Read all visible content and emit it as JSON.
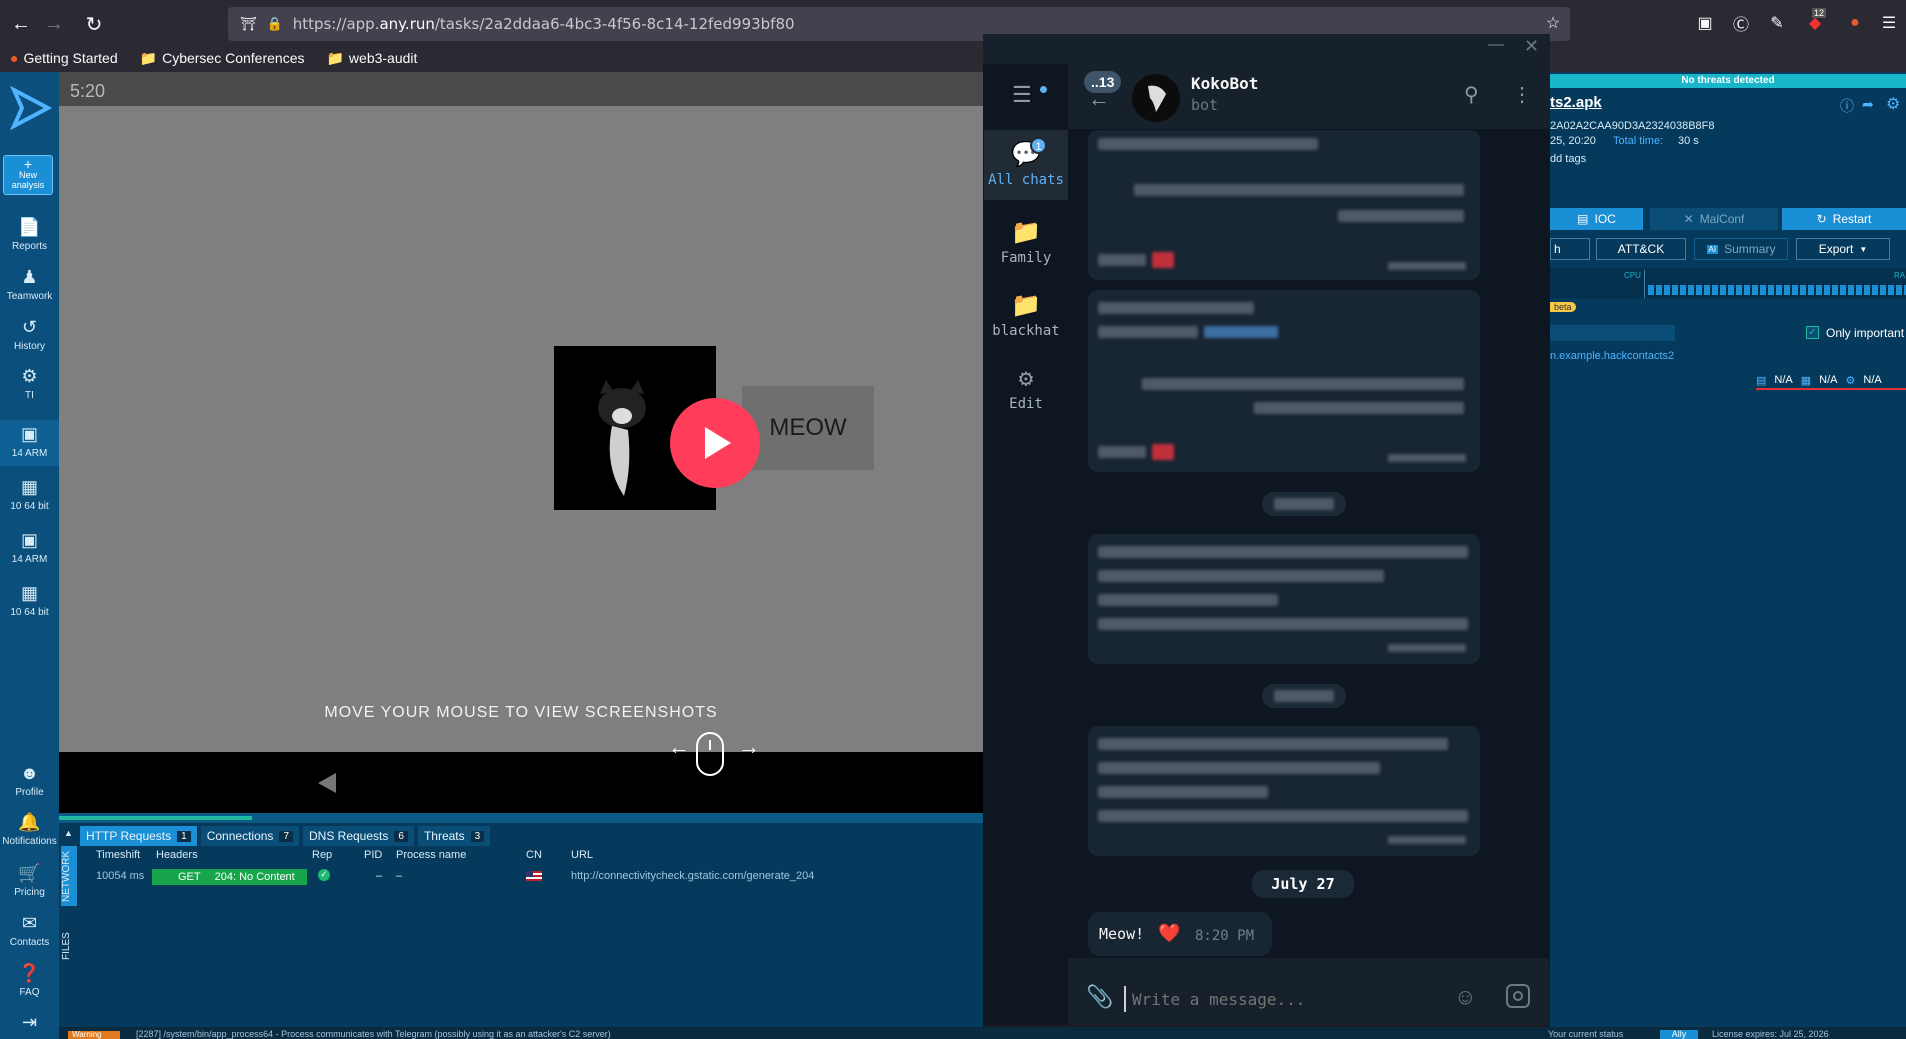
{
  "browser": {
    "url_prefix": "https://app.",
    "url_domain": "any.run",
    "url_path": "/tasks/2a2ddaa6-4bc3-4f56-8c14-12fed993bf80",
    "badge_count": "12",
    "bookmarks": [
      "Getting Started",
      "Cybersec Conferences",
      "web3-audit"
    ]
  },
  "sidebar": {
    "new_analysis": "New analysis",
    "items": [
      "Reports",
      "Teamwork",
      "History",
      "TI",
      "14 ARM",
      "10 64 bit",
      "14 ARM",
      "10 64 bit"
    ],
    "bottom_items": [
      "Profile",
      "Notifications",
      "Pricing",
      "Contacts",
      "FAQ"
    ]
  },
  "video": {
    "timer": "5:20",
    "meow_button": "MEOW",
    "hint": "MOVE YOUR MOUSE TO VIEW SCREENSHOTS"
  },
  "network": {
    "vertical_tabs": [
      "NETWORK",
      "FILES"
    ],
    "tabs": [
      {
        "label": "HTTP Requests",
        "count": "1"
      },
      {
        "label": "Connections",
        "count": "7"
      },
      {
        "label": "DNS Requests",
        "count": "6"
      },
      {
        "label": "Threats",
        "count": "3"
      }
    ],
    "headers": [
      "Timeshift",
      "Headers",
      "Rep",
      "PID",
      "Process name",
      "CN",
      "URL"
    ],
    "row": {
      "timeshift": "10054 ms",
      "method": "GET",
      "status": "204: No Content",
      "pid": "–",
      "process": "–",
      "url": "http://connectivitycheck.gstatic.com/generate_204"
    }
  },
  "telegram": {
    "unread_back": "..13",
    "chat_name": "KokoBot",
    "chat_sub": "bot",
    "folders": [
      {
        "label": "All chats",
        "badge": "1"
      },
      {
        "label": "Family"
      },
      {
        "label": "blackhat"
      },
      {
        "label": "Edit"
      }
    ],
    "date_label": "July 27",
    "last_message": {
      "text": "Meow!",
      "emoji": "❤️",
      "time": "8:20 PM"
    },
    "input_placeholder": "Write a message..."
  },
  "analysis": {
    "status_banner": "No threats detected",
    "file_name": "ts2.apk",
    "hash": "2A02A2CAA90D3A2324038B8F8",
    "date": "25, 20:20",
    "total_time_label": "Total time:",
    "total_time": "30 s",
    "add_tags": "dd tags",
    "buttons_row1": [
      "IOC",
      "MalConf",
      "Restart"
    ],
    "buttons_row2": [
      "h",
      "ATT&CK",
      "Summary",
      "Export"
    ],
    "cpu_label": "CPU",
    "ram_label": "RA",
    "beta": "beta",
    "only_important": "Only important",
    "process_name": "n.example.hackcontacts2",
    "na_values": [
      "N/A",
      "N/A",
      "N/A"
    ]
  },
  "bottom": {
    "warning_label": "Warning",
    "warning_text": "[2287] /system/bin/app_process64 - Process communicates with Telegram (possibly using it as an attacker's C2 server)",
    "status_text": "Your current status",
    "status_value": "Ally",
    "license": "License expires: Jul 25, 2026"
  }
}
